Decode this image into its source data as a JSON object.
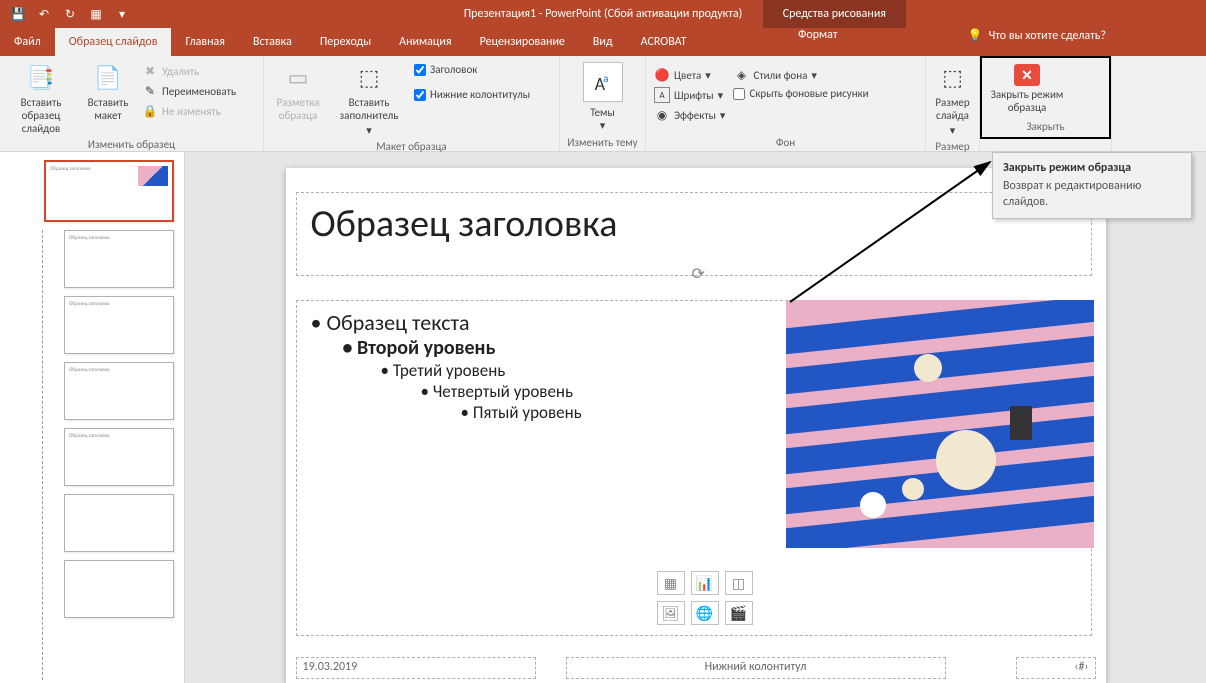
{
  "app": {
    "title": "Презентация1 - PowerPoint (Сбой активации продукта)",
    "context_tab": "Средства рисования"
  },
  "tabs": {
    "file": "Файл",
    "master": "Образец слайдов",
    "home": "Главная",
    "insert": "Вставка",
    "transitions": "Переходы",
    "animations": "Анимация",
    "review": "Рецензирование",
    "view": "Вид",
    "acrobat": "ACROBAT",
    "format": "Формат",
    "tellme": "Что вы хотите сделать?"
  },
  "ribbon": {
    "edit_master": {
      "insert_master": "Вставить образец слайдов",
      "insert_layout": "Вставить макет",
      "delete": "Удалить",
      "rename": "Переименовать",
      "preserve": "Не изменять",
      "label": "Изменить образец"
    },
    "master_layout": {
      "master_layout": "Разметка образца",
      "insert_placeholder": "Вставить заполнитель",
      "title_chk": "Заголовок",
      "footers_chk": "Нижние колонтитулы",
      "label": "Макет образца"
    },
    "edit_theme": {
      "themes": "Темы",
      "label": "Изменить тему"
    },
    "background": {
      "colors": "Цвета",
      "fonts": "Шрифты",
      "effects": "Эффекты",
      "bg_styles": "Стили фона",
      "hide_bg": "Скрыть фоновые рисунки",
      "label": "Фон"
    },
    "size": {
      "slide_size": "Размер слайда",
      "label": "Размер"
    },
    "close": {
      "close_master": "Закрыть режим образца",
      "label": "Закрыть"
    }
  },
  "tooltip": {
    "title": "Закрыть режим образца",
    "body": "Возврат к редактированию слайдов."
  },
  "slide": {
    "title": "Образец заголовка",
    "b1": "Образец текста",
    "b2": "Второй уровень",
    "b3": "Третий уровень",
    "b4": "Четвертый уровень",
    "b5": "Пятый уровень",
    "date": "19.03.2019",
    "footer": "Нижний колонтитул",
    "num": "‹#›"
  },
  "thumbs": {
    "mini_title": "Образец заголовка"
  }
}
